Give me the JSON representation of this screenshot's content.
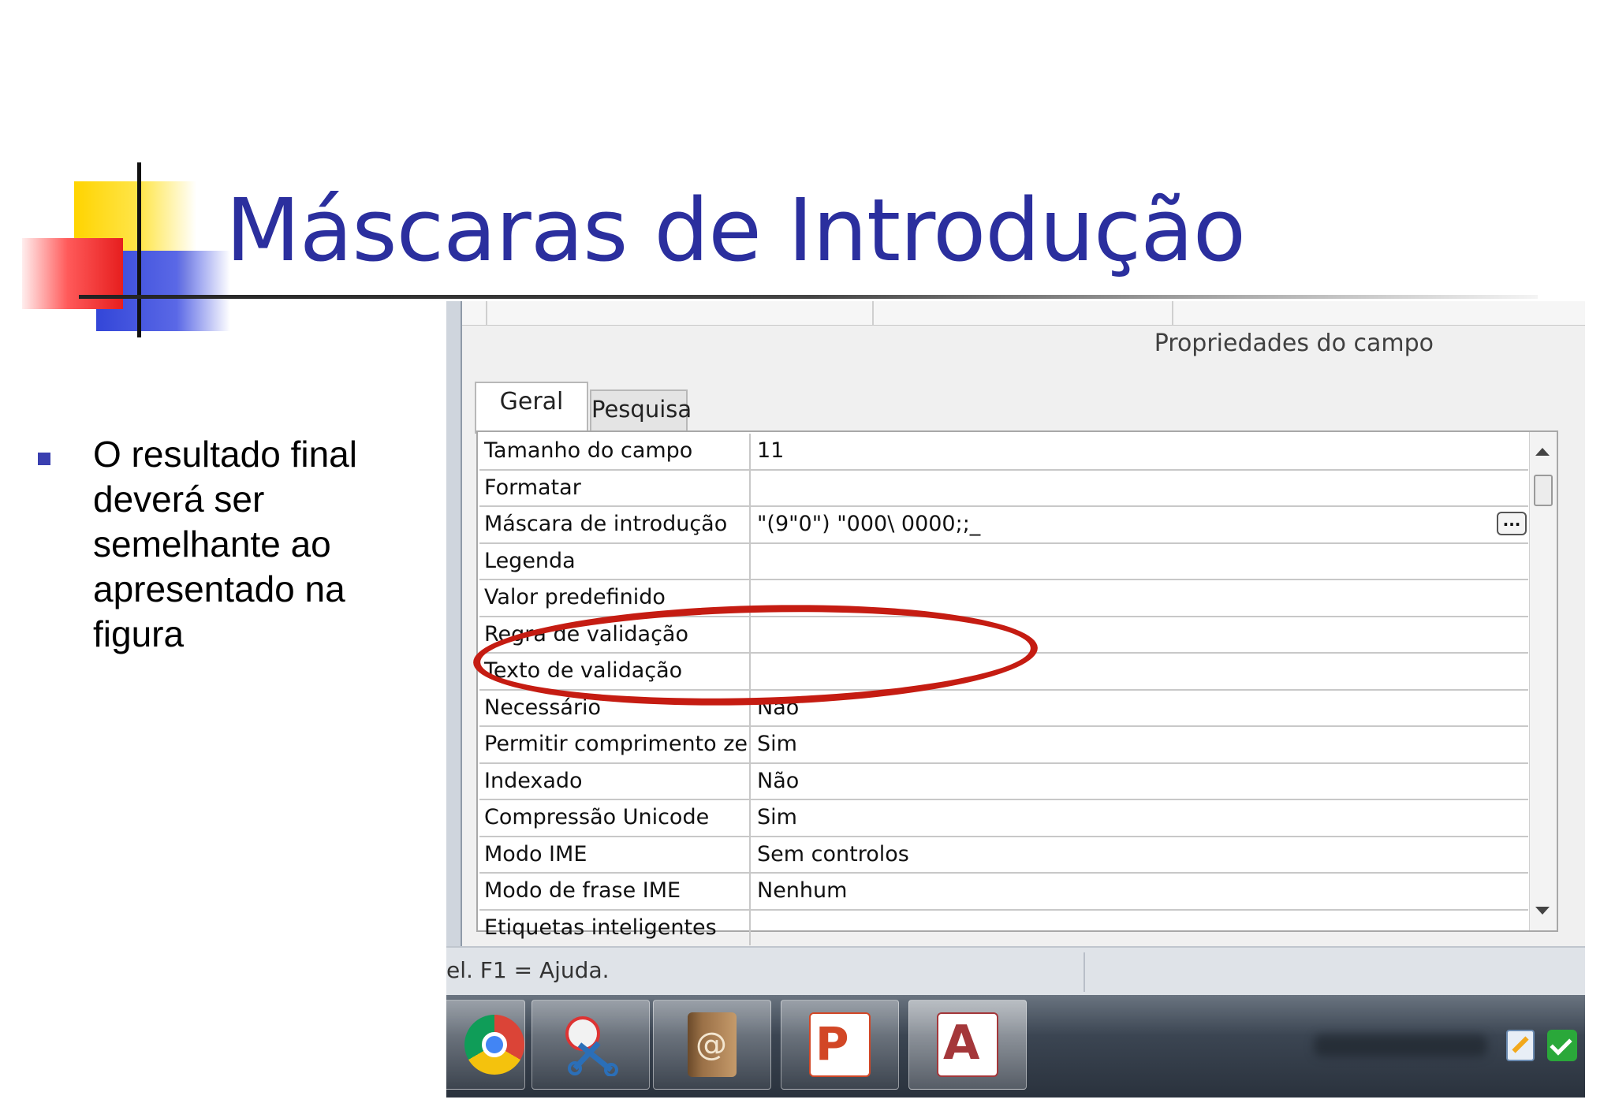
{
  "slide": {
    "title": "Máscaras de Introdução",
    "bullet": "O resultado final deverá ser semelhante ao apresentado na figura"
  },
  "properties_panel": {
    "title": "Propriedades do campo",
    "tabs": [
      {
        "label": "Geral",
        "active": true
      },
      {
        "label": "Pesquisa",
        "active": false
      }
    ],
    "rows": [
      {
        "name": "Tamanho do campo",
        "value": "11"
      },
      {
        "name": "Formatar",
        "value": ""
      },
      {
        "name": "Máscara de introdução",
        "value": "\"(9\"0\") \"000\\ 0000;;_"
      },
      {
        "name": "Legenda",
        "value": ""
      },
      {
        "name": "Valor predefinido",
        "value": ""
      },
      {
        "name": "Regra de validação",
        "value": ""
      },
      {
        "name": "Texto de validação",
        "value": ""
      },
      {
        "name": "Necessário",
        "value": "Não"
      },
      {
        "name": "Permitir comprimento zer",
        "value": "Sim"
      },
      {
        "name": "Indexado",
        "value": "Não"
      },
      {
        "name": "Compressão Unicode",
        "value": "Sim"
      },
      {
        "name": "Modo IME",
        "value": "Sem controlos"
      },
      {
        "name": "Modo de frase IME",
        "value": "Nenhum"
      },
      {
        "name": "Etiquetas inteligentes",
        "value": ""
      }
    ],
    "builder_button": "...",
    "highlight_color": "#c51c12"
  },
  "status_bar": {
    "text": "el. F1 = Ajuda."
  },
  "taskbar": {
    "items": [
      {
        "icon": "chrome-icon"
      },
      {
        "icon": "snipping-tool-icon"
      },
      {
        "icon": "contacts-icon",
        "glyph": "@"
      },
      {
        "icon": "powerpoint-icon",
        "glyph": "P"
      },
      {
        "icon": "access-icon",
        "glyph": "A"
      }
    ],
    "tray": [
      {
        "icon": "notes-pen-icon"
      },
      {
        "icon": "security-check-icon"
      }
    ]
  },
  "colors": {
    "title": "#2b2f9e",
    "bullet": "#3a3fb0"
  }
}
